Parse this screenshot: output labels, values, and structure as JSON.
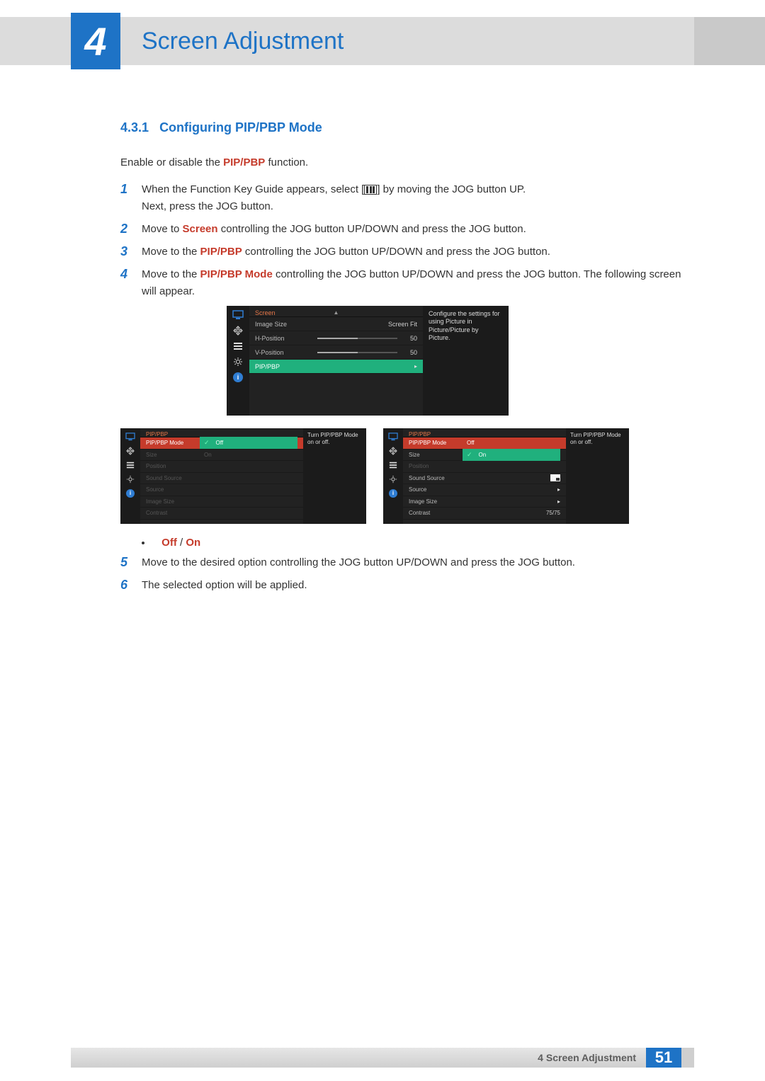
{
  "chapter_number": "4",
  "chapter_title": "Screen Adjustment",
  "section": {
    "number": "4.3.1",
    "title": "Configuring PIP/PBP Mode"
  },
  "intro": {
    "pre": "Enable or disable the ",
    "hl": "PIP/PBP",
    "post": " function."
  },
  "steps": {
    "1": {
      "a": "When the Function Key Guide appears, select [",
      "b": "] by moving the JOG button UP.",
      "c": "Next, press the JOG button."
    },
    "2": {
      "a": "Move to ",
      "hl": "Screen",
      "b": " controlling the JOG button UP/DOWN and press the JOG button."
    },
    "3": {
      "a": "Move to the ",
      "hl": "PIP/PBP",
      "b": " controlling the JOG button UP/DOWN and press the JOG button."
    },
    "4": {
      "a": "Move to the ",
      "hl": "PIP/PBP Mode",
      "b": " controlling the JOG button UP/DOWN and press the JOG button. The following screen will appear."
    },
    "5": "Move to the desired option controlling the JOG button UP/DOWN and press the JOG button.",
    "6": "The selected option will be applied."
  },
  "bullet": {
    "off": "Off",
    "sep": " / ",
    "on": "On"
  },
  "osd1": {
    "title": "Screen",
    "help": "Configure the settings for using Picture in Picture/Picture by Picture.",
    "rows": {
      "image_size": {
        "label": "Image Size",
        "value": "Screen Fit"
      },
      "hpos": {
        "label": "H-Position",
        "value": "50"
      },
      "vpos": {
        "label": "V-Position",
        "value": "50"
      },
      "pippbp": {
        "label": "PIP/PBP"
      }
    }
  },
  "osd2": {
    "title": "PIP/PBP",
    "help": "Turn PIP/PBP Mode on or off.",
    "rows": {
      "mode": {
        "label": "PIP/PBP Mode",
        "off": "Off",
        "on": "On"
      },
      "size": {
        "label": "Size"
      },
      "position": {
        "label": "Position"
      },
      "sound": {
        "label": "Sound Source"
      },
      "source": {
        "label": "Source"
      },
      "img": {
        "label": "Image Size"
      },
      "contrast": {
        "label": "Contrast"
      }
    }
  },
  "osd3": {
    "title": "PIP/PBP",
    "help": "Turn PIP/PBP Mode on or off.",
    "rows": {
      "mode": {
        "label": "PIP/PBP Mode",
        "off": "Off",
        "on": "On"
      },
      "size": {
        "label": "Size"
      },
      "position": {
        "label": "Position"
      },
      "sound": {
        "label": "Sound Source"
      },
      "source": {
        "label": "Source"
      },
      "img": {
        "label": "Image Size"
      },
      "contrast": {
        "label": "Contrast",
        "value": "75/75"
      }
    }
  },
  "footer": {
    "chapnum": "4",
    "title": "Screen Adjustment",
    "page": "51"
  }
}
